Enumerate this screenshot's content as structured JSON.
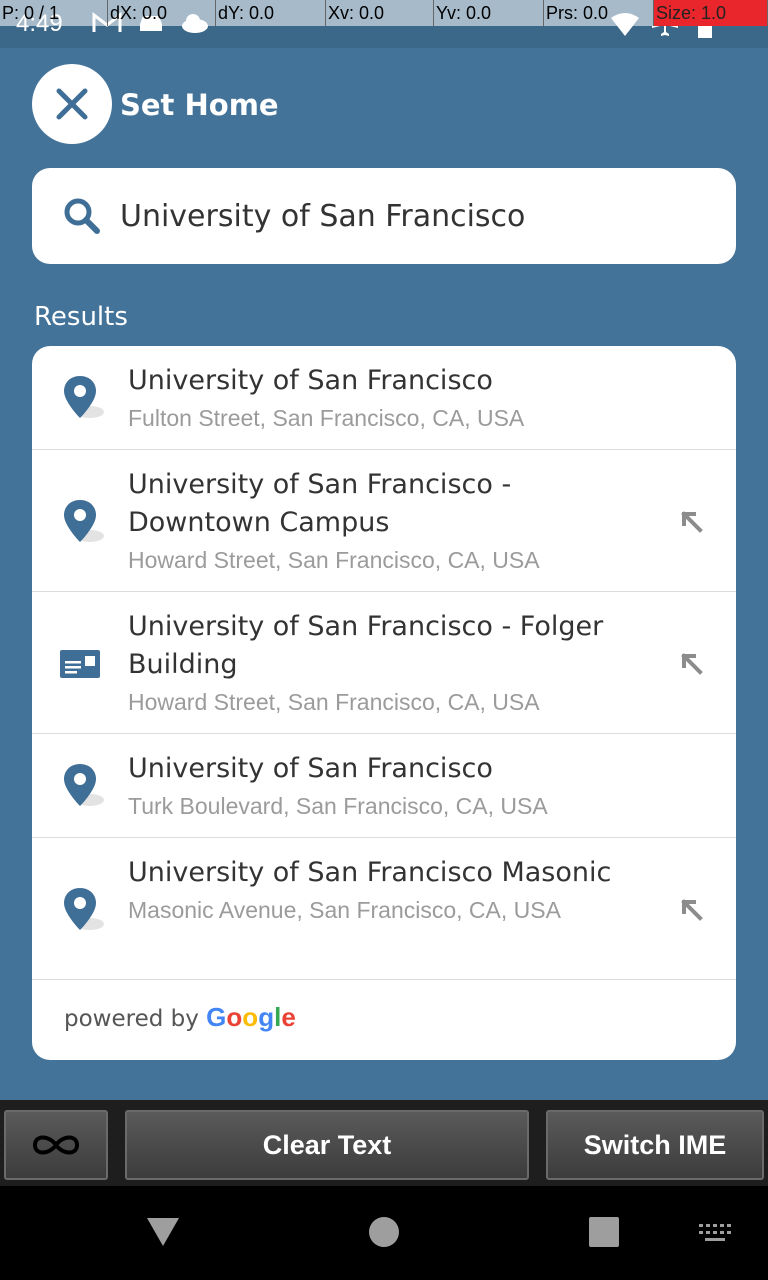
{
  "debug": {
    "cells": [
      "P: 0 / 1",
      "dX: 0.0",
      "dY: 0.0",
      "Xv: 0.0",
      "Yv: 0.0",
      "Prs: 0.0",
      "Size: 1.0"
    ]
  },
  "status": {
    "time": "4:49"
  },
  "header": {
    "title": "Set Home",
    "close_icon": "close-icon"
  },
  "search": {
    "value": "University of San Francisco",
    "icon": "search-icon"
  },
  "results": {
    "label": "Results",
    "items": [
      {
        "title": "University of San Francisco",
        "subtitle": "Fulton Street, San Francisco, CA, USA",
        "icon": "map-pin-icon",
        "has_fill_arrow": false
      },
      {
        "title": "University of San Francisco - Downtown Campus",
        "subtitle": "Howard Street, San Francisco, CA, USA",
        "icon": "map-pin-icon",
        "has_fill_arrow": true
      },
      {
        "title": "University of San Francisco - Folger Building",
        "subtitle": "Howard Street, San Francisco, CA, USA",
        "icon": "business-card-icon",
        "has_fill_arrow": true
      },
      {
        "title": "University of San Francisco",
        "subtitle": "Turk Boulevard, San Francisco, CA, USA",
        "icon": "map-pin-icon",
        "has_fill_arrow": false
      },
      {
        "title": "University of San Francisco Masonic",
        "subtitle": "Masonic Avenue, San Francisco, CA, USA",
        "icon": "map-pin-icon",
        "has_fill_arrow": true
      }
    ],
    "powered_by": "powered by",
    "google": [
      "G",
      "o",
      "o",
      "g",
      "l",
      "e"
    ]
  },
  "ime_bar": {
    "infinity_icon": "infinity-icon",
    "clear_text": "Clear Text",
    "switch_ime": "Switch IME"
  },
  "colors": {
    "background": "#447399",
    "accent": "#3f6f96",
    "card": "#ffffff"
  }
}
